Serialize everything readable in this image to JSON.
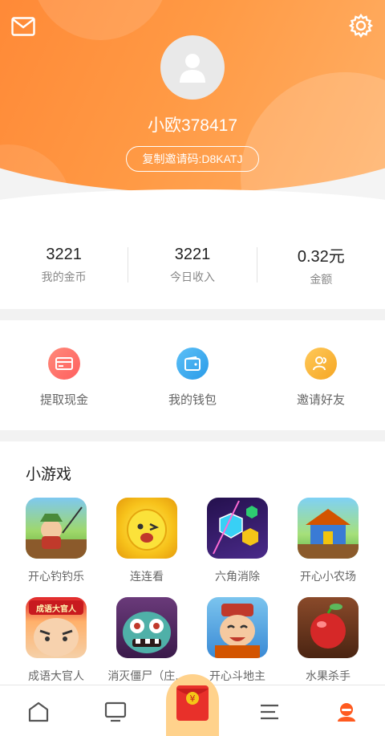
{
  "header": {
    "username": "小欧378417",
    "invite_label": "复制邀请码:D8KATJ"
  },
  "stats": [
    {
      "value": "3221",
      "label": "我的金币"
    },
    {
      "value": "3221",
      "label": "今日收入"
    },
    {
      "value": "0.32元",
      "label": "金额"
    }
  ],
  "actions": [
    {
      "label": "提取现金",
      "icon": "card-icon",
      "color": "#ff6a64"
    },
    {
      "label": "我的钱包",
      "icon": "wallet-icon",
      "color": "#39a7f0"
    },
    {
      "label": "邀请好友",
      "icon": "friends-icon",
      "color": "#f5a623"
    }
  ],
  "games": {
    "title": "小游戏",
    "items": [
      {
        "name": "开心钓钓乐"
      },
      {
        "name": "连连看"
      },
      {
        "name": "六角消除"
      },
      {
        "name": "开心小农场"
      },
      {
        "name": "成语大官人",
        "badge": "成语大官人"
      },
      {
        "name": "消灭僵尸（庄..."
      },
      {
        "name": "开心斗地主"
      },
      {
        "name": "水果杀手"
      }
    ]
  },
  "nav": {
    "items": [
      "home-icon",
      "tv-icon",
      "red-envelope-icon",
      "list-icon",
      "profile-icon"
    ],
    "active_color": "#ff5a1f",
    "envelope_symbol": "¥"
  }
}
